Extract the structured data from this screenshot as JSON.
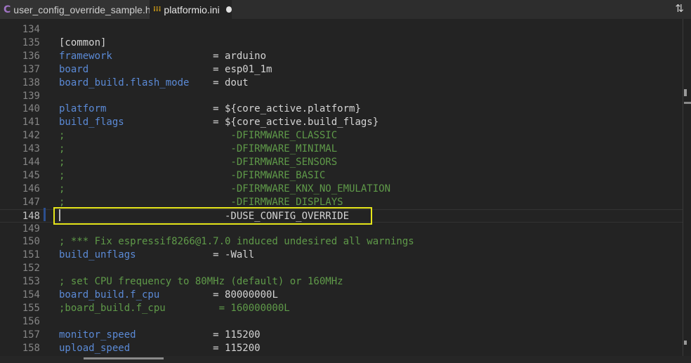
{
  "tabs": [
    {
      "label": "user_config_override_sample.h",
      "icon": "c-file-icon",
      "icon_glyph": "C",
      "icon_color": "#a074c4"
    },
    {
      "label": "platformio.ini",
      "icon": "ini-file-icon",
      "icon_glyph": "⁞⁞⁞",
      "icon_color": "#d4a017",
      "modified": true
    }
  ],
  "toolbar": {
    "sync_icon": "⇅"
  },
  "colors": {
    "key": "#5b8ad6",
    "value": "#d4d4d4",
    "comment": "#5f9a49",
    "highlight_box": "#e6e61a"
  },
  "current_line": 148,
  "lines": [
    {
      "n": "134",
      "s": []
    },
    {
      "n": "135",
      "s": [
        {
          "t": "[common]",
          "c": "v"
        }
      ]
    },
    {
      "n": "136",
      "s": [
        {
          "t": "framework",
          "c": "k"
        },
        {
          "t": "                 = arduino",
          "c": "v"
        }
      ]
    },
    {
      "n": "137",
      "s": [
        {
          "t": "board",
          "c": "k"
        },
        {
          "t": "                     = esp01_1m",
          "c": "v"
        }
      ]
    },
    {
      "n": "138",
      "s": [
        {
          "t": "board_build.flash_mode",
          "c": "k"
        },
        {
          "t": "    = dout",
          "c": "v"
        }
      ]
    },
    {
      "n": "139",
      "s": []
    },
    {
      "n": "140",
      "s": [
        {
          "t": "platform",
          "c": "k"
        },
        {
          "t": "                  = ${core_active.platform}",
          "c": "v"
        }
      ]
    },
    {
      "n": "141",
      "s": [
        {
          "t": "build_flags",
          "c": "k"
        },
        {
          "t": "               = ${core_active.build_flags}",
          "c": "v"
        }
      ]
    },
    {
      "n": "142",
      "s": [
        {
          "t": ";                            -DFIRMWARE_CLASSIC",
          "c": "c"
        }
      ]
    },
    {
      "n": "143",
      "s": [
        {
          "t": ";                            -DFIRMWARE_MINIMAL",
          "c": "c"
        }
      ]
    },
    {
      "n": "144",
      "s": [
        {
          "t": ";                            -DFIRMWARE_SENSORS",
          "c": "c"
        }
      ]
    },
    {
      "n": "145",
      "s": [
        {
          "t": ";                            -DFIRMWARE_BASIC",
          "c": "c"
        }
      ]
    },
    {
      "n": "146",
      "s": [
        {
          "t": ";                            -DFIRMWARE_KNX_NO_EMULATION",
          "c": "c"
        }
      ]
    },
    {
      "n": "147",
      "s": [
        {
          "t": ";                            -DFIRMWARE_DISPLAYS",
          "c": "c"
        }
      ]
    },
    {
      "n": "148",
      "s": [
        {
          "t": "                            -DUSE_CONFIG_OVERRIDE",
          "c": "v"
        }
      ]
    },
    {
      "n": "149",
      "s": []
    },
    {
      "n": "150",
      "s": [
        {
          "t": "; *** Fix espressif8266@1.7.0 induced undesired all warnings",
          "c": "c"
        }
      ]
    },
    {
      "n": "151",
      "s": [
        {
          "t": "build_unflags",
          "c": "k"
        },
        {
          "t": "             = -Wall",
          "c": "v"
        }
      ]
    },
    {
      "n": "152",
      "s": []
    },
    {
      "n": "153",
      "s": [
        {
          "t": "; set CPU frequency to 80MHz (default) or 160MHz",
          "c": "c"
        }
      ]
    },
    {
      "n": "154",
      "s": [
        {
          "t": "board_build.f_cpu",
          "c": "k"
        },
        {
          "t": "         = 80000000L",
          "c": "v"
        }
      ]
    },
    {
      "n": "155",
      "s": [
        {
          "t": ";board_build.f_cpu         = 160000000L",
          "c": "c"
        }
      ]
    },
    {
      "n": "156",
      "s": []
    },
    {
      "n": "157",
      "s": [
        {
          "t": "monitor_speed",
          "c": "k"
        },
        {
          "t": "             = 115200",
          "c": "v"
        }
      ]
    },
    {
      "n": "158",
      "s": [
        {
          "t": "upload_speed",
          "c": "k"
        },
        {
          "t": "              = 115200",
          "c": "v"
        }
      ]
    }
  ]
}
